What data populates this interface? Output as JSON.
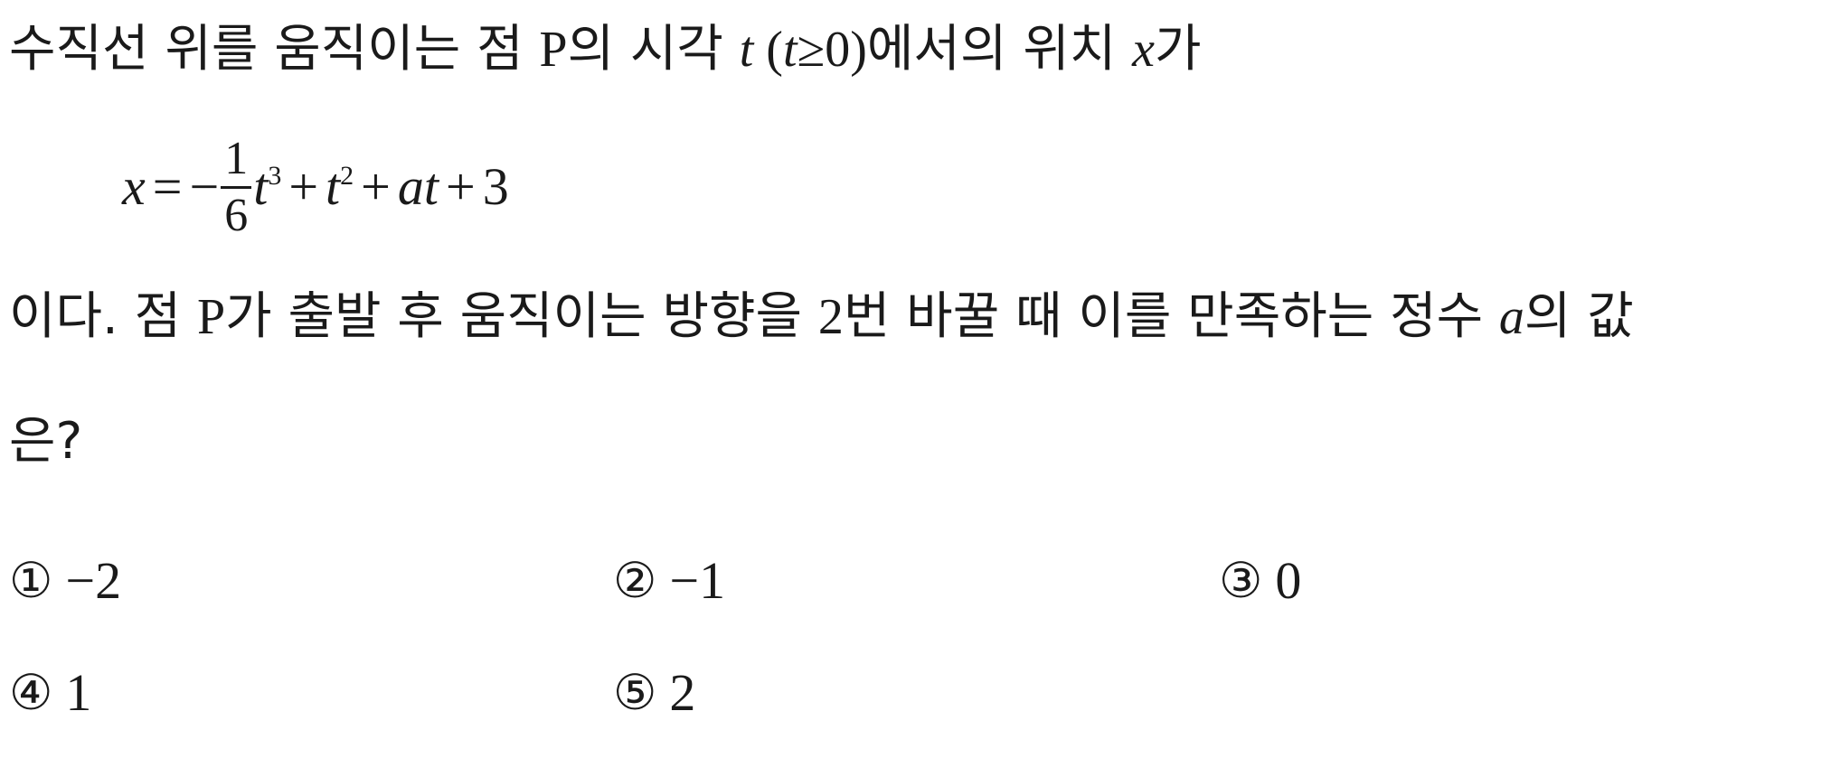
{
  "problem": {
    "line1": {
      "s1": "수직선 위를 움직이는 점 ",
      "P": "P",
      "s2": "의 시각 ",
      "t": "t",
      "paren_open": " (",
      "t2": "t",
      "geq": "≥",
      "zero": "0",
      "paren_close": ")",
      "s3": "에서의 위치 ",
      "x": "x",
      "s4": "가"
    },
    "equation": {
      "x": "x",
      "equals": "=",
      "minus": "−",
      "frac_num": "1",
      "frac_den": "6",
      "t3_base": "t",
      "t3_exp": "3",
      "plus1": "+",
      "t2_base": "t",
      "t2_exp": "2",
      "plus2": "+",
      "a": "a",
      "t": "t",
      "plus3": "+",
      "const": "3"
    },
    "line3": {
      "s1": "이다. 점 ",
      "P": "P",
      "s2": "가 출발 후 움직이는 방향을 ",
      "two": "2",
      "s3": "번 바꿀 때 이를 만족하는 정수 ",
      "a": "a",
      "s4": "의 값"
    },
    "line4": {
      "s1": "은?"
    }
  },
  "choices": [
    {
      "mark": "①",
      "value": "−2"
    },
    {
      "mark": "②",
      "value": "−1"
    },
    {
      "mark": "③",
      "value": "0"
    },
    {
      "mark": "④",
      "value": "1"
    },
    {
      "mark": "⑤",
      "value": "2"
    }
  ]
}
